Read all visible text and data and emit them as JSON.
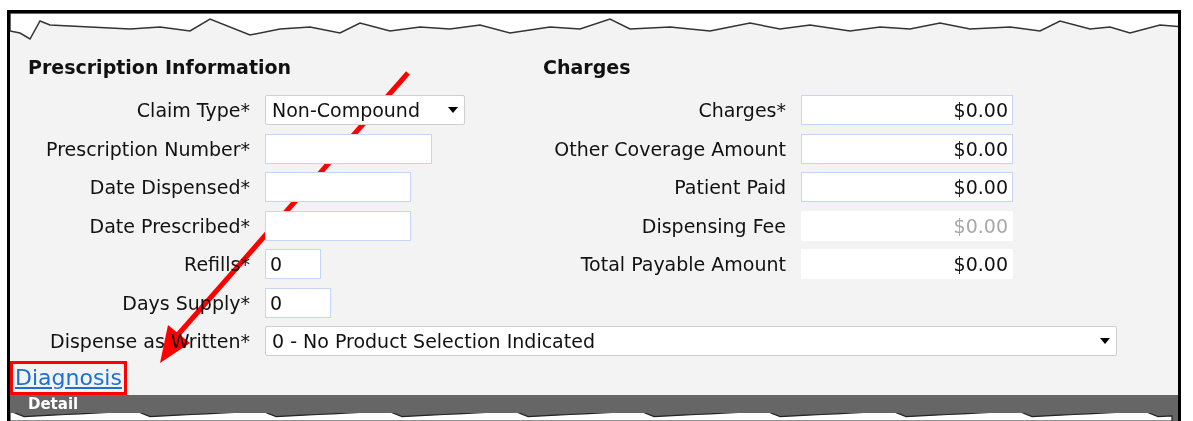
{
  "prescription": {
    "title": "Prescription Information",
    "fields": [
      {
        "label": "Claim Type*",
        "kind": "select",
        "value": "Non-Compound"
      },
      {
        "label": "Prescription Number*",
        "kind": "text"
      },
      {
        "label": "Date Dispensed*",
        "kind": "text"
      },
      {
        "label": "Date Prescribed*",
        "kind": "text"
      },
      {
        "label": "Refills*",
        "kind": "text",
        "value": "0"
      },
      {
        "label": "Days Supply*",
        "kind": "text",
        "value": "0"
      }
    ]
  },
  "charges": {
    "title": "Charges",
    "fields": [
      {
        "label": "Charges*",
        "kind": "text",
        "value": "$0.00",
        "disabled": false
      },
      {
        "label": "Other Coverage Amount",
        "kind": "text",
        "value": "$0.00",
        "disabled": false
      },
      {
        "label": "Patient Paid",
        "kind": "text",
        "value": "$0.00",
        "disabled": false
      },
      {
        "label": "Dispensing Fee",
        "kind": "readonly",
        "value": "$0.00",
        "disabled": true
      },
      {
        "label": "Total Payable Amount",
        "kind": "readonly",
        "value": "$0.00",
        "disabled": false
      }
    ]
  },
  "dispense": {
    "label": "Dispense as Written*",
    "kind": "select",
    "value": "0 - No Product Selection Indicated"
  },
  "diagnosis_link": {
    "label": "Diagnosis",
    "highlighted": true
  },
  "detail_bar": {
    "title": "Detail"
  }
}
